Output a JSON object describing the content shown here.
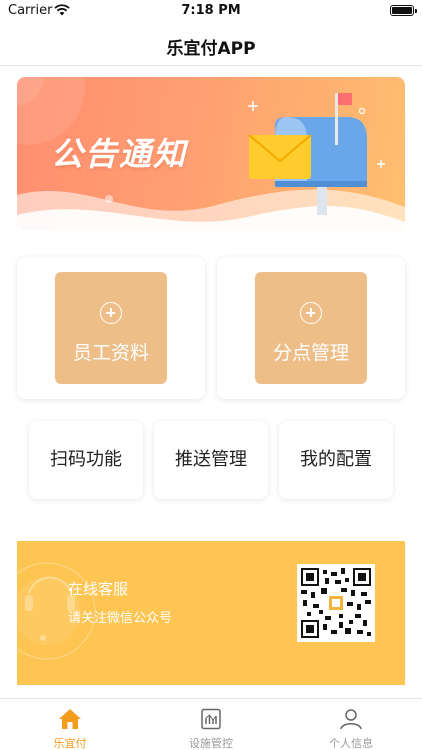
{
  "status_bar": {
    "carrier": "Carrier",
    "time": "7:18 PM",
    "icons": [
      "wifi-icon",
      "battery-icon"
    ]
  },
  "nav": {
    "title": "乐宜付APP"
  },
  "banner": {
    "title": "公告通知",
    "illustration": "mailbox-icon"
  },
  "tiles": [
    {
      "label": "员工资料",
      "icon": "plus-circle-icon"
    },
    {
      "label": "分点管理",
      "icon": "plus-circle-icon"
    }
  ],
  "functions": [
    {
      "label": "扫码功能"
    },
    {
      "label": "推送管理"
    },
    {
      "label": "我的配置"
    }
  ],
  "service": {
    "title": "在线客服",
    "subtitle": "请关注微信公众号",
    "qr_icon": "qr-code-icon"
  },
  "tab_bar": {
    "tabs": [
      {
        "label": "乐宜付",
        "icon": "home-icon",
        "active": true
      },
      {
        "label": "设施管控",
        "icon": "chart-icon",
        "active": false
      },
      {
        "label": "个人信息",
        "icon": "user-icon",
        "active": false
      }
    ]
  },
  "colors": {
    "accent": "#f39c1e",
    "banner_start": "#ff8e6f",
    "banner_end": "#ffc070",
    "tile_fill": "#eebe89",
    "service_fill": "#fec553"
  }
}
